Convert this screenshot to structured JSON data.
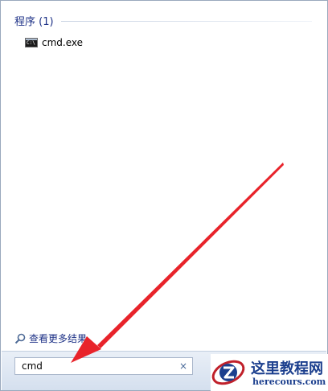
{
  "results": {
    "section_header": "程序 (1)",
    "items": [
      {
        "label": "cmd.exe",
        "icon": "cmd-icon"
      }
    ],
    "see_more": "查看更多结果"
  },
  "search": {
    "value": "cmd",
    "clear_glyph": "×"
  },
  "watermark": {
    "title": "这里教程网",
    "subtitle": "herecours.com"
  },
  "colors": {
    "header_text": "#1e3287",
    "arrow": "#e8232a",
    "watermark": "#1c3f8e"
  }
}
